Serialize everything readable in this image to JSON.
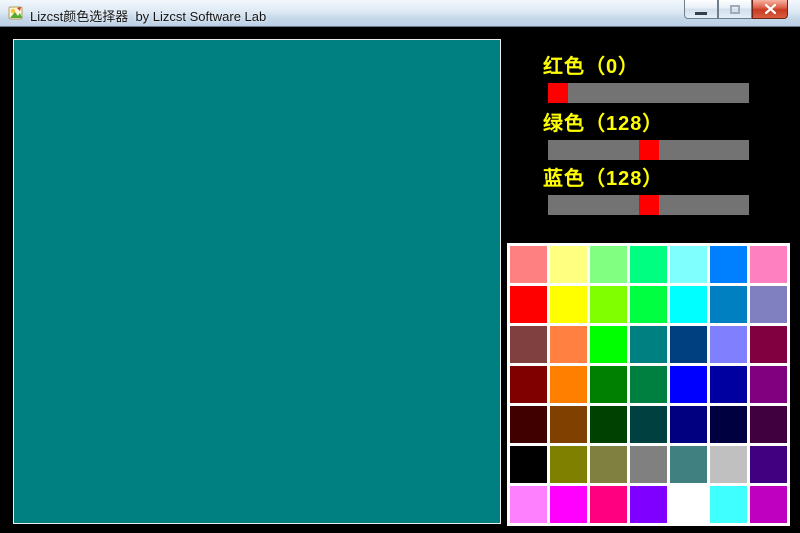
{
  "window": {
    "title": "Lizcst颜色选择器  by Lizcst Software Lab",
    "controls": {
      "minimize_icon": "minimize-dash",
      "maximize_icon": "maximize-square-disabled",
      "close_icon": "close-x"
    }
  },
  "colors": {
    "client_background": "#000000",
    "label_text": "#ffff00",
    "slider_track": "#737373",
    "slider_thumb": "#ff0000",
    "palette_grid": "#ffffff",
    "preview_color": "#008080"
  },
  "preview": {
    "color": "#008080"
  },
  "sliders": [
    {
      "name": "red",
      "label": "红色（0）",
      "value": 0,
      "max": 255
    },
    {
      "name": "green",
      "label": "绿色（128）",
      "value": 128,
      "max": 255
    },
    {
      "name": "blue",
      "label": "蓝色（128）",
      "value": 128,
      "max": 255
    }
  ],
  "palette": {
    "rows": 7,
    "cols": 7,
    "colors": [
      "#FF8080",
      "#FFFF80",
      "#80FF80",
      "#00FF80",
      "#80FFFF",
      "#0080FF",
      "#FF80C0",
      "#FF0000",
      "#FFFF00",
      "#80FF00",
      "#00FF40",
      "#00FFFF",
      "#0080C0",
      "#8080C0",
      "#804040",
      "#FF8040",
      "#00FF00",
      "#008080",
      "#004080",
      "#8080FF",
      "#800040",
      "#800000",
      "#FF8000",
      "#008000",
      "#008040",
      "#0000FF",
      "#0000A0",
      "#800080",
      "#400000",
      "#804000",
      "#004000",
      "#004040",
      "#000080",
      "#000040",
      "#400040",
      "#000000",
      "#808000",
      "#808040",
      "#808080",
      "#408080",
      "#C0C0C0",
      "#400080",
      "#FF80FF",
      "#FF00FF",
      "#FF0080",
      "#8000FF",
      "#FFFFFF",
      "#40FFFF",
      "#C000C0"
    ]
  }
}
